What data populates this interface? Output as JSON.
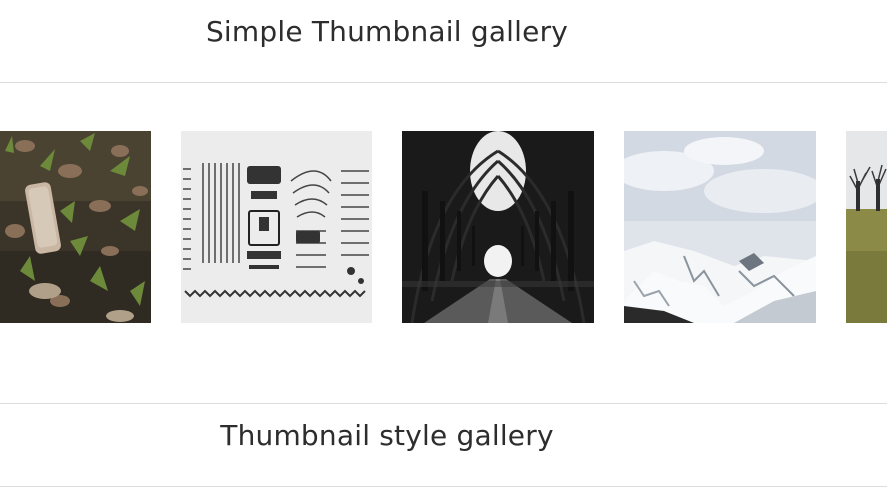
{
  "gallery": {
    "simple_title": "Simple Thumbnail gallery",
    "thumbnail_style_title": "Thumbnail style gallery",
    "thumbnails": [
      {
        "name": "leaves-and-bottle-photo"
      },
      {
        "name": "typewriter-parts-photo"
      },
      {
        "name": "tree-tunnel-road-photo"
      },
      {
        "name": "snowy-mountains-photo"
      },
      {
        "name": "trees-on-field-photo"
      }
    ]
  }
}
